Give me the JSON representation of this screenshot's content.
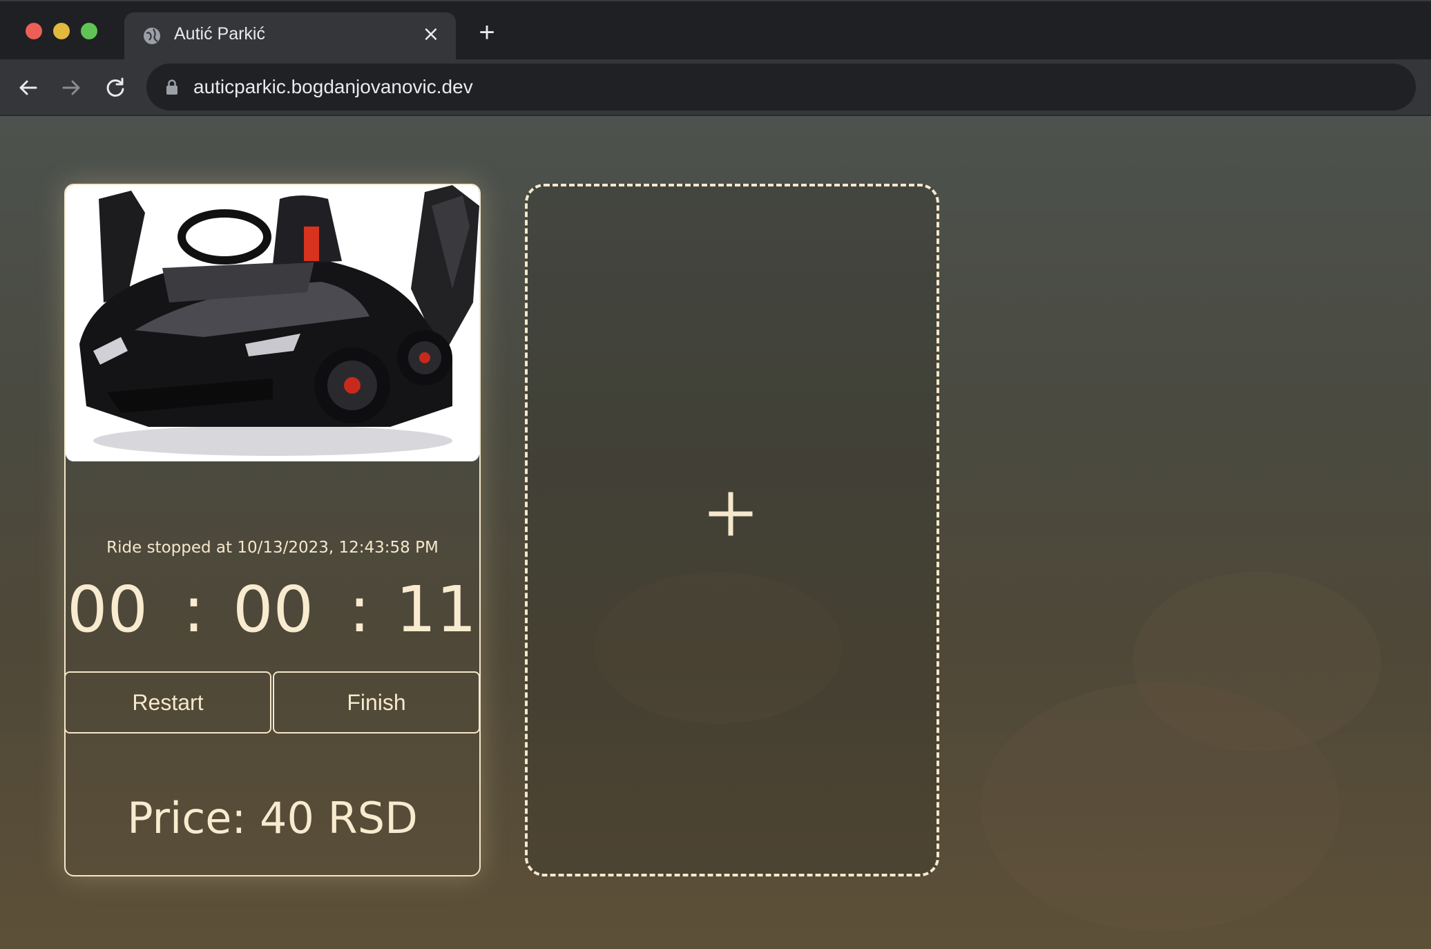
{
  "browser": {
    "tab_title": "Autić Parkić",
    "tab_close": "×",
    "new_tab": "+",
    "url": "auticparkic.bogdanjovanovic.dev"
  },
  "ride_card": {
    "status": "Ride stopped at 10/13/2023, 12:43:58 PM",
    "timer": {
      "hours": "00",
      "minutes": "00",
      "seconds": "11",
      "separator": ":"
    },
    "buttons": {
      "restart": "Restart",
      "finish": "Finish"
    },
    "price": "Price: 40 RSD"
  },
  "add_card": {
    "icon": "plus-icon"
  },
  "colors": {
    "accent": "#f5e8cc",
    "chrome": "#35363a"
  }
}
